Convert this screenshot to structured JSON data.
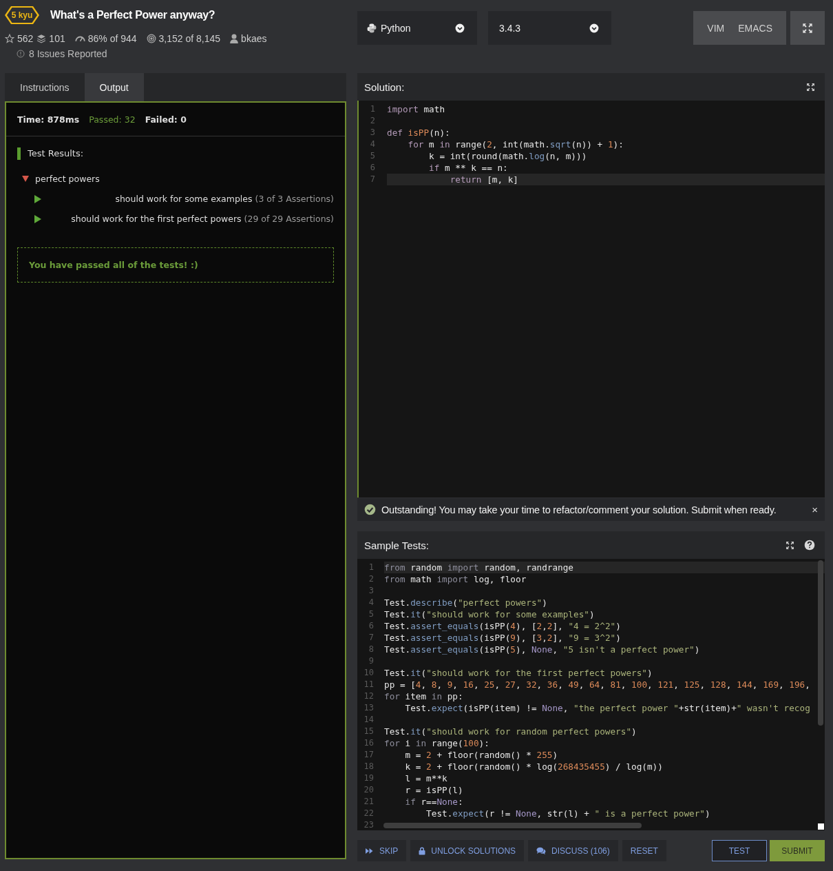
{
  "kata": {
    "rank": "5 kyu",
    "title": "What's a Perfect Power anyway?",
    "stats": [
      {
        "kind": "star",
        "text": "562"
      },
      {
        "kind": "layers",
        "text": "101"
      },
      {
        "kind": "gauge",
        "text": "86% of 944"
      },
      {
        "kind": "target",
        "text": "3,152 of 8,145"
      },
      {
        "kind": "user",
        "text": "bkaes"
      }
    ],
    "issues": "8 Issues Reported"
  },
  "language": {
    "value": "Python"
  },
  "version": {
    "value": "3.4.3"
  },
  "keymaps": [
    "VIM",
    "EMACS"
  ],
  "tabs": [
    {
      "label": "Instructions",
      "selected": false
    },
    {
      "label": "Output",
      "selected": true
    }
  ],
  "output": {
    "time": "Time: 878ms",
    "passed": "Passed: 32",
    "failed": "Failed: 0",
    "heading": "Test Results:",
    "results": [
      {
        "title": "perfect powers",
        "expanded": true,
        "children": [
          {
            "title": "should work for some examples",
            "count": "(3 of 3 Assertions)",
            "expanded": false
          },
          {
            "title": "should work for the first perfect powers",
            "count": "(29 of 29 Assertions)",
            "expanded": false
          }
        ]
      }
    ],
    "message": "You have passed all of the tests! :)"
  },
  "solution": {
    "title": "Solution:",
    "lines": [
      {
        "number": "1",
        "active": false,
        "tokens": [
          {
            "kind": "k",
            "text": "import"
          },
          {
            "kind": "p",
            "text": " math"
          }
        ]
      },
      {
        "number": "2",
        "active": false
      },
      {
        "number": "3",
        "active": false,
        "tokens": [
          {
            "kind": "k",
            "text": "def "
          },
          {
            "kind": "d",
            "text": "isPP"
          },
          {
            "kind": "p",
            "text": "(n):"
          }
        ]
      },
      {
        "number": "4",
        "active": false,
        "tokens": [
          {
            "kind": "k",
            "text": "    for"
          },
          {
            "kind": "p",
            "text": " m "
          },
          {
            "kind": "k",
            "text": "in"
          },
          {
            "kind": "p",
            "text": " range("
          },
          {
            "kind": "n",
            "text": "2"
          },
          {
            "kind": "p",
            "text": ", int(math."
          },
          {
            "kind": "f",
            "text": "sqrt"
          },
          {
            "kind": "p",
            "text": "(n)) + "
          },
          {
            "kind": "n",
            "text": "1"
          },
          {
            "kind": "p",
            "text": "):"
          }
        ]
      },
      {
        "number": "5",
        "active": false,
        "tokens": [
          {
            "kind": "p",
            "text": "        k = int(round(math."
          },
          {
            "kind": "f",
            "text": "log"
          },
          {
            "kind": "p",
            "text": "(n, m)))"
          }
        ]
      },
      {
        "number": "6",
        "active": false,
        "tokens": [
          {
            "kind": "k",
            "text": "        if"
          },
          {
            "kind": "p",
            "text": " m ** k == n:"
          }
        ]
      },
      {
        "number": "7",
        "active": true,
        "tokens": [
          {
            "kind": "k",
            "text": "            return"
          },
          {
            "kind": "p",
            "text": " [m, k]"
          }
        ]
      }
    ]
  },
  "notice": {
    "text": "Outstanding! You may take your time to refactor/comment your solution. Submit when ready.",
    "close": "×"
  },
  "sample_tests": {
    "title": "Sample Tests:",
    "lines": [
      {
        "number": "1",
        "active": true,
        "tokens": [
          {
            "kind": "k",
            "text": "from"
          },
          {
            "kind": "p",
            "text": " random "
          },
          {
            "kind": "k",
            "text": "import"
          },
          {
            "kind": "p",
            "text": " random, randrange"
          }
        ]
      },
      {
        "number": "2",
        "active": false,
        "tokens": [
          {
            "kind": "k",
            "text": "from"
          },
          {
            "kind": "p",
            "text": " math "
          },
          {
            "kind": "k",
            "text": "import"
          },
          {
            "kind": "p",
            "text": " log, floor"
          }
        ]
      },
      {
        "number": "3",
        "active": false
      },
      {
        "number": "4",
        "active": false,
        "tokens": [
          {
            "kind": "p",
            "text": "Test."
          },
          {
            "kind": "f",
            "text": "describe"
          },
          {
            "kind": "p",
            "text": "("
          },
          {
            "kind": "s",
            "text": "\"perfect powers\""
          },
          {
            "kind": "p",
            "text": ")"
          }
        ]
      },
      {
        "number": "5",
        "active": false,
        "tokens": [
          {
            "kind": "p",
            "text": "Test."
          },
          {
            "kind": "f",
            "text": "it"
          },
          {
            "kind": "p",
            "text": "("
          },
          {
            "kind": "s",
            "text": "\"should work for some examples\""
          },
          {
            "kind": "p",
            "text": ")"
          }
        ]
      },
      {
        "number": "6",
        "active": false,
        "tokens": [
          {
            "kind": "p",
            "text": "Test."
          },
          {
            "kind": "f",
            "text": "assert_equals"
          },
          {
            "kind": "p",
            "text": "(isPP("
          },
          {
            "kind": "n",
            "text": "4"
          },
          {
            "kind": "p",
            "text": "), ["
          },
          {
            "kind": "n",
            "text": "2"
          },
          {
            "kind": "p",
            "text": ","
          },
          {
            "kind": "n",
            "text": "2"
          },
          {
            "kind": "p",
            "text": "], "
          },
          {
            "kind": "s",
            "text": "\"4 = 2^2\""
          },
          {
            "kind": "p",
            "text": ")"
          }
        ]
      },
      {
        "number": "7",
        "active": false,
        "tokens": [
          {
            "kind": "p",
            "text": "Test."
          },
          {
            "kind": "f",
            "text": "assert_equals"
          },
          {
            "kind": "p",
            "text": "(isPP("
          },
          {
            "kind": "n",
            "text": "9"
          },
          {
            "kind": "p",
            "text": "), ["
          },
          {
            "kind": "n",
            "text": "3"
          },
          {
            "kind": "p",
            "text": ","
          },
          {
            "kind": "n",
            "text": "2"
          },
          {
            "kind": "p",
            "text": "], "
          },
          {
            "kind": "s",
            "text": "\"9 = 3^2\""
          },
          {
            "kind": "p",
            "text": ")"
          }
        ]
      },
      {
        "number": "8",
        "active": false,
        "tokens": [
          {
            "kind": "p",
            "text": "Test."
          },
          {
            "kind": "f",
            "text": "assert_equals"
          },
          {
            "kind": "p",
            "text": "(isPP("
          },
          {
            "kind": "n",
            "text": "5"
          },
          {
            "kind": "p",
            "text": "), "
          },
          {
            "kind": "c",
            "text": "None"
          },
          {
            "kind": "p",
            "text": ", "
          },
          {
            "kind": "s",
            "text": "\"5 isn't a perfect power\""
          },
          {
            "kind": "p",
            "text": ")"
          }
        ]
      },
      {
        "number": "9",
        "active": false
      },
      {
        "number": "10",
        "active": false,
        "tokens": [
          {
            "kind": "p",
            "text": "Test."
          },
          {
            "kind": "f",
            "text": "it"
          },
          {
            "kind": "p",
            "text": "("
          },
          {
            "kind": "s",
            "text": "\"should work for the first perfect powers\""
          },
          {
            "kind": "p",
            "text": ")"
          }
        ]
      },
      {
        "number": "11",
        "active": false,
        "tokens": [
          {
            "kind": "p",
            "text": "pp = ["
          },
          {
            "kind": "n",
            "text": "4"
          },
          {
            "kind": "p",
            "text": ", "
          },
          {
            "kind": "n",
            "text": "8"
          },
          {
            "kind": "p",
            "text": ", "
          },
          {
            "kind": "n",
            "text": "9"
          },
          {
            "kind": "p",
            "text": ", "
          },
          {
            "kind": "n",
            "text": "16"
          },
          {
            "kind": "p",
            "text": ", "
          },
          {
            "kind": "n",
            "text": "25"
          },
          {
            "kind": "p",
            "text": ", "
          },
          {
            "kind": "n",
            "text": "27"
          },
          {
            "kind": "p",
            "text": ", "
          },
          {
            "kind": "n",
            "text": "32"
          },
          {
            "kind": "p",
            "text": ", "
          },
          {
            "kind": "n",
            "text": "36"
          },
          {
            "kind": "p",
            "text": ", "
          },
          {
            "kind": "n",
            "text": "49"
          },
          {
            "kind": "p",
            "text": ", "
          },
          {
            "kind": "n",
            "text": "64"
          },
          {
            "kind": "p",
            "text": ", "
          },
          {
            "kind": "n",
            "text": "81"
          },
          {
            "kind": "p",
            "text": ", "
          },
          {
            "kind": "n",
            "text": "100"
          },
          {
            "kind": "p",
            "text": ", "
          },
          {
            "kind": "n",
            "text": "121"
          },
          {
            "kind": "p",
            "text": ", "
          },
          {
            "kind": "n",
            "text": "125"
          },
          {
            "kind": "p",
            "text": ", "
          },
          {
            "kind": "n",
            "text": "128"
          },
          {
            "kind": "p",
            "text": ", "
          },
          {
            "kind": "n",
            "text": "144"
          },
          {
            "kind": "p",
            "text": ", "
          },
          {
            "kind": "n",
            "text": "169"
          },
          {
            "kind": "p",
            "text": ", "
          },
          {
            "kind": "n",
            "text": "196"
          },
          {
            "kind": "p",
            "text": ","
          }
        ]
      },
      {
        "number": "12",
        "active": false,
        "tokens": [
          {
            "kind": "k",
            "text": "for"
          },
          {
            "kind": "p",
            "text": " item "
          },
          {
            "kind": "k",
            "text": "in"
          },
          {
            "kind": "p",
            "text": " pp:"
          }
        ]
      },
      {
        "number": "13",
        "active": false,
        "tokens": [
          {
            "kind": "p",
            "text": "    Test."
          },
          {
            "kind": "f",
            "text": "expect"
          },
          {
            "kind": "p",
            "text": "(isPP(item) != "
          },
          {
            "kind": "c",
            "text": "None"
          },
          {
            "kind": "p",
            "text": ", "
          },
          {
            "kind": "s",
            "text": "\"the perfect power \""
          },
          {
            "kind": "p",
            "text": "+str(item)+"
          },
          {
            "kind": "s",
            "text": "\" wasn't recog"
          }
        ]
      },
      {
        "number": "14",
        "active": false
      },
      {
        "number": "15",
        "active": false,
        "tokens": [
          {
            "kind": "p",
            "text": "Test."
          },
          {
            "kind": "f",
            "text": "it"
          },
          {
            "kind": "p",
            "text": "("
          },
          {
            "kind": "s",
            "text": "\"should work for random perfect powers\""
          },
          {
            "kind": "p",
            "text": ")"
          }
        ]
      },
      {
        "number": "16",
        "active": false,
        "tokens": [
          {
            "kind": "k",
            "text": "for"
          },
          {
            "kind": "p",
            "text": " i "
          },
          {
            "kind": "k",
            "text": "in"
          },
          {
            "kind": "p",
            "text": " range("
          },
          {
            "kind": "n",
            "text": "100"
          },
          {
            "kind": "p",
            "text": "):"
          }
        ]
      },
      {
        "number": "17",
        "active": false,
        "tokens": [
          {
            "kind": "p",
            "text": "    m = "
          },
          {
            "kind": "n",
            "text": "2"
          },
          {
            "kind": "p",
            "text": " + floor(random() * "
          },
          {
            "kind": "n",
            "text": "255"
          },
          {
            "kind": "p",
            "text": ")"
          }
        ]
      },
      {
        "number": "18",
        "active": false,
        "tokens": [
          {
            "kind": "p",
            "text": "    k = "
          },
          {
            "kind": "n",
            "text": "2"
          },
          {
            "kind": "p",
            "text": " + floor(random() * log("
          },
          {
            "kind": "n",
            "text": "268435455"
          },
          {
            "kind": "p",
            "text": ") / log(m))"
          }
        ]
      },
      {
        "number": "19",
        "active": false,
        "tokens": [
          {
            "kind": "p",
            "text": "    l = m**k"
          }
        ]
      },
      {
        "number": "20",
        "active": false,
        "tokens": [
          {
            "kind": "p",
            "text": "    r = isPP(l)"
          }
        ]
      },
      {
        "number": "21",
        "active": false,
        "tokens": [
          {
            "kind": "k",
            "text": "    if"
          },
          {
            "kind": "p",
            "text": " r=="
          },
          {
            "kind": "c",
            "text": "None"
          },
          {
            "kind": "p",
            "text": ":"
          }
        ]
      },
      {
        "number": "22",
        "active": false,
        "tokens": [
          {
            "kind": "p",
            "text": "        Test."
          },
          {
            "kind": "f",
            "text": "expect"
          },
          {
            "kind": "p",
            "text": "(r != "
          },
          {
            "kind": "c",
            "text": "None"
          },
          {
            "kind": "p",
            "text": ", str(l) + "
          },
          {
            "kind": "s",
            "text": "\" is a perfect power\""
          },
          {
            "kind": "p",
            "text": ")"
          }
        ]
      },
      {
        "number": "23",
        "active": false
      }
    ]
  },
  "actions": [
    {
      "kind": "skip",
      "label": "SKIP"
    },
    {
      "kind": "unlock",
      "label": "UNLOCK SOLUTIONS"
    },
    {
      "kind": "discuss",
      "label": "DISCUSS (106)"
    },
    {
      "kind": "reset",
      "label": "RESET"
    }
  ],
  "submit_actions": [
    {
      "kind": "outline",
      "label": "TEST"
    },
    {
      "kind": "primary",
      "label": "SUBMIT"
    }
  ]
}
